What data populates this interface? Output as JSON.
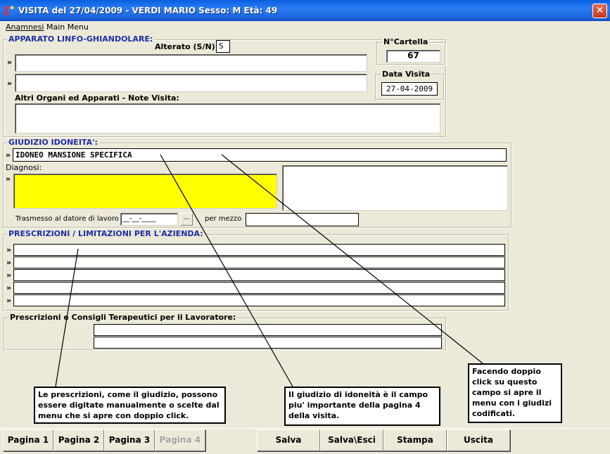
{
  "window": {
    "title": "VISITA del 27/04/2009 -  VERDI MARIO Sesso: M Età: 49",
    "close_glyph": "✕"
  },
  "menu": [
    "Anamnesi",
    "Main Menu"
  ],
  "apparato": {
    "title": "APPARATO LINFO-GHIANDOLARE:",
    "alterato_label": "Alterato (S/N):",
    "alterato_value": "S",
    "arrow": "»",
    "line1": "",
    "line2": "",
    "altri_label": "Altri Organi ed Apparati - Note Visita:",
    "altri_value": ""
  },
  "cartella": {
    "label": "N°Cartella",
    "value": "67"
  },
  "data_visita": {
    "label": "Data Visita",
    "value": "27-04-2009"
  },
  "giudizio": {
    "title": "GIUDIZIO IDONEITA':",
    "arrow": "»",
    "value": "IDONEO MANSIONE SPECIFICA",
    "diagnosi_label": "Diagnosi:",
    "diagnosi_value": "",
    "diagnosi_notes": "",
    "trasmesso_label": "Trasmesso al datore di lavoro il",
    "trasmesso_value": "__-__-____",
    "ellipsis": "...",
    "per_mezzo_label": "per mezzo",
    "per_mezzo_value": ""
  },
  "prescrizioni": {
    "title": "PRESCRIZIONI / LIMITAZIONI PER L'AZIENDA:",
    "arrow": "»",
    "lines": [
      "",
      "",
      "",
      "",
      ""
    ]
  },
  "consigli": {
    "title": "Prescrizioni e Consigli Terapeutici per il Lavoratore:",
    "lines": [
      "",
      ""
    ]
  },
  "notes": {
    "prescrizioni": "Le prescrizioni, come il giudizio, possono essere digitate manualmente o scelte dal menu che si apre con doppio click.",
    "giudizio": "Il giudizio di idoneità è il campo piu' importante della pagina 4 della visita.",
    "doppio_click": "Facendo doppio click su questo campo si apre il menu con i giudizi codificati."
  },
  "buttons": {
    "pagina1": "Pagina 1",
    "pagina2": "Pagina 2",
    "pagina3": "Pagina 3",
    "pagina4": "Pagina 4",
    "salva": "Salva",
    "salva_esci": "Salva\\Esci",
    "stampa": "Stampa",
    "uscita": "Uscita"
  },
  "colors": {
    "titlebar": "#0a5fe0",
    "window_bg": "#ece9d8",
    "section_title": "#1c2fa8",
    "diagnosi_bg": "#ffff00"
  }
}
